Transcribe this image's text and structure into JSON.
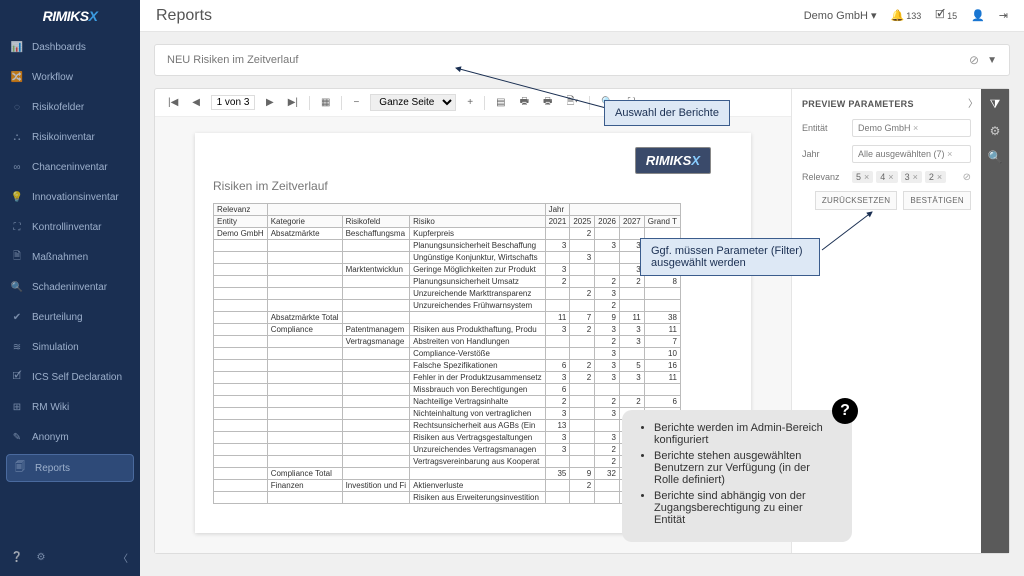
{
  "brand": {
    "name": "RIMIKS",
    "x": "X"
  },
  "page_title": "Reports",
  "entity_selector": "Demo GmbH",
  "header": {
    "bell_count": "133",
    "check_count": "15"
  },
  "sidebar": {
    "items": [
      {
        "icon": "📊",
        "label": "Dashboards"
      },
      {
        "icon": "🔀",
        "label": "Workflow"
      },
      {
        "icon": "◌",
        "label": "Risikofelder"
      },
      {
        "icon": "⛬",
        "label": "Risikoinventar"
      },
      {
        "icon": "∞",
        "label": "Chanceninventar"
      },
      {
        "icon": "💡",
        "label": "Innovationsinventar"
      },
      {
        "icon": "⛶",
        "label": "Kontrollinventar"
      },
      {
        "icon": "🗎",
        "label": "Maßnahmen"
      },
      {
        "icon": "🔍",
        "label": "Schadeninventar"
      },
      {
        "icon": "✔",
        "label": "Beurteilung"
      },
      {
        "icon": "≋",
        "label": "Simulation"
      },
      {
        "icon": "🗹",
        "label": "ICS Self Declaration"
      },
      {
        "icon": "⊞",
        "label": "RM Wiki"
      },
      {
        "icon": "✎",
        "label": "Anonym"
      },
      {
        "icon": "🗐",
        "label": "Reports"
      }
    ]
  },
  "report_select": {
    "value": "NEU Risiken im Zeitverlauf"
  },
  "toolbar": {
    "page_text": "1 von 3",
    "zoom": "Ganze Seite"
  },
  "report": {
    "title": "Risiken im Zeitverlauf",
    "headers": {
      "relevanz": "Relevanz",
      "entity": "Entity",
      "kategorie": "Kategorie",
      "risikofeld": "Risikofeld",
      "risiko": "Risiko",
      "jahr": "Jahr",
      "y1": "2021",
      "y2": "2025",
      "y3": "2026",
      "y4": "2027",
      "gt": "Grand T"
    },
    "rows": [
      {
        "entity": "Demo GmbH",
        "kategorie": "Absatzmärkte",
        "risikofeld": "Beschaffungsma",
        "risiko": "Kupferpreis",
        "v": [
          "",
          "2",
          "",
          "",
          ""
        ]
      },
      {
        "risiko": "Planungsunsicherheit Beschaffung",
        "v": [
          "3",
          "",
          "3",
          "3",
          "3"
        ]
      },
      {
        "risiko": "Ungünstige Konjunktur, Wirtschafts",
        "v": [
          "",
          "3",
          "",
          "",
          ""
        ]
      },
      {
        "risikofeld": "Marktentwicklun",
        "risiko": "Geringe Möglichkeiten zur Produkt",
        "v": [
          "3",
          "",
          "",
          "3",
          ""
        ]
      },
      {
        "risiko": "Planungsunsicherheit Umsatz",
        "v": [
          "2",
          "",
          "2",
          "2",
          "8"
        ]
      },
      {
        "risiko": "Unzureichende Markttransparenz",
        "v": [
          "",
          "2",
          "3",
          "",
          ""
        ]
      },
      {
        "risiko": "Unzureichendes Frühwarnsystem",
        "v": [
          "",
          "",
          "2",
          "",
          ""
        ]
      },
      {
        "kategorie": "Absatzmärkte Total",
        "v": [
          "11",
          "7",
          "9",
          "11",
          "38"
        ]
      },
      {
        "kategorie": "Compliance",
        "risikofeld": "Patentmanagem",
        "risiko": "Risiken aus Produkthaftung, Produ",
        "v": [
          "3",
          "2",
          "3",
          "3",
          "11"
        ]
      },
      {
        "risikofeld": "Vertragsmanage",
        "risiko": "Abstreiten von Handlungen",
        "v": [
          "",
          "",
          "2",
          "3",
          "7"
        ]
      },
      {
        "risiko": "Compliance-Verstöße",
        "v": [
          "",
          "",
          "3",
          "",
          "10"
        ]
      },
      {
        "risiko": "Falsche Spezifikationen",
        "v": [
          "6",
          "2",
          "3",
          "5",
          "16"
        ]
      },
      {
        "risiko": "Fehler in der Produktzusammensetz",
        "v": [
          "3",
          "2",
          "3",
          "3",
          "11"
        ]
      },
      {
        "risiko": "Missbrauch von Berechtigungen",
        "v": [
          "6",
          "",
          "",
          "",
          ""
        ]
      },
      {
        "risiko": "Nachteilige Vertragsinhalte",
        "v": [
          "2",
          "",
          "2",
          "2",
          "6"
        ]
      },
      {
        "risiko": "Nichteinhaltung von vertraglichen",
        "v": [
          "3",
          "",
          "3",
          "3",
          "9"
        ]
      },
      {
        "risiko": "Rechtsunsicherheit aus AGBs (Ein",
        "v": [
          "13",
          "",
          "",
          "",
          ""
        ]
      },
      {
        "risiko": "Risiken aus Vertragsgestaltungen",
        "v": [
          "3",
          "",
          "3",
          "3",
          "9"
        ]
      },
      {
        "risiko": "Unzureichendes Vertragsmanagen",
        "v": [
          "3",
          "",
          "2",
          "2",
          "7"
        ]
      },
      {
        "risiko": "Vertragsvereinbarung aus Kooperat",
        "v": [
          "",
          "",
          "2",
          "2",
          "4"
        ]
      },
      {
        "kategorie": "Compliance Total",
        "v": [
          "35",
          "9",
          "32",
          "43",
          "119"
        ]
      },
      {
        "kategorie": "Finanzen",
        "risikofeld": "Investition und Fi",
        "risiko": "Aktienverluste",
        "v": [
          "",
          "2",
          "",
          "",
          "2"
        ]
      },
      {
        "risiko": "Risiken aus Erweiterungsinvestition",
        "v": [
          "",
          "",
          "",
          "",
          ""
        ]
      }
    ]
  },
  "params": {
    "title": "PREVIEW PARAMETERS",
    "entitaet_label": "Entität",
    "entitaet_value": "Demo GmbH",
    "jahr_label": "Jahr",
    "jahr_value": "Alle ausgewählten (7)",
    "relevanz_label": "Relevanz",
    "relevanz_chips": [
      "5",
      "4",
      "3",
      "2"
    ],
    "reset": "ZURÜCKSETZEN",
    "submit": "BESTÄTIGEN"
  },
  "callouts": {
    "c1": "Auswahl der Berichte",
    "c2": "Ggf. müssen Parameter (Filter) ausgewählt werden"
  },
  "help": {
    "items": [
      "Berichte werden im Admin-Bereich konfiguriert",
      "Berichte stehen ausgewählten Benutzern zur Verfügung (in der Rolle definiert)",
      "Berichte sind abhängig von der Zugangsberechtigung zu einer Entität"
    ]
  }
}
